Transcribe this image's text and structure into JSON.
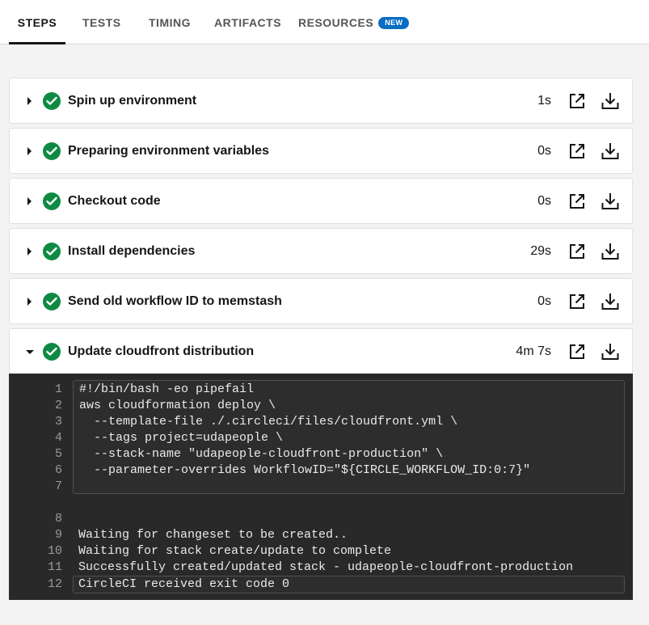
{
  "tabs": [
    {
      "label": "STEPS"
    },
    {
      "label": "TESTS"
    },
    {
      "label": "TIMING"
    },
    {
      "label": "ARTIFACTS"
    },
    {
      "label": "RESOURCES",
      "badge": "NEW"
    }
  ],
  "steps": [
    {
      "title": "Spin up environment",
      "duration": "1s",
      "status": "success"
    },
    {
      "title": "Preparing environment variables",
      "duration": "0s",
      "status": "success"
    },
    {
      "title": "Checkout code",
      "duration": "0s",
      "status": "success"
    },
    {
      "title": "Install dependencies",
      "duration": "29s",
      "status": "success"
    },
    {
      "title": "Send old workflow ID to memstash",
      "duration": "0s",
      "status": "success"
    },
    {
      "title": "Update cloudfront distribution",
      "duration": "4m 7s",
      "status": "success",
      "expanded": true
    }
  ],
  "console": {
    "line_numbers": [
      "1",
      "2",
      "3",
      "4",
      "5",
      "6",
      "7",
      "8",
      "9",
      "10",
      "11",
      "12"
    ],
    "command": [
      "#!/bin/bash -eo pipefail",
      "aws cloudformation deploy \\",
      "  --template-file ./.circleci/files/cloudfront.yml \\",
      "  --tags project=udapeople \\",
      "  --stack-name \"udapeople-cloudfront-production\" \\",
      "  --parameter-overrides WorkflowID=\"${CIRCLE_WORKFLOW_ID:0:7}\"",
      ""
    ],
    "output": [
      "",
      "Waiting for changeset to be created..",
      "Waiting for stack create/update to complete",
      "Successfully created/updated stack - udapeople-cloudfront-production",
      "CircleCI received exit code 0"
    ]
  },
  "colors": {
    "success": "#0f8a43",
    "badge": "#0a6dc2",
    "console_bg": "#292929"
  }
}
